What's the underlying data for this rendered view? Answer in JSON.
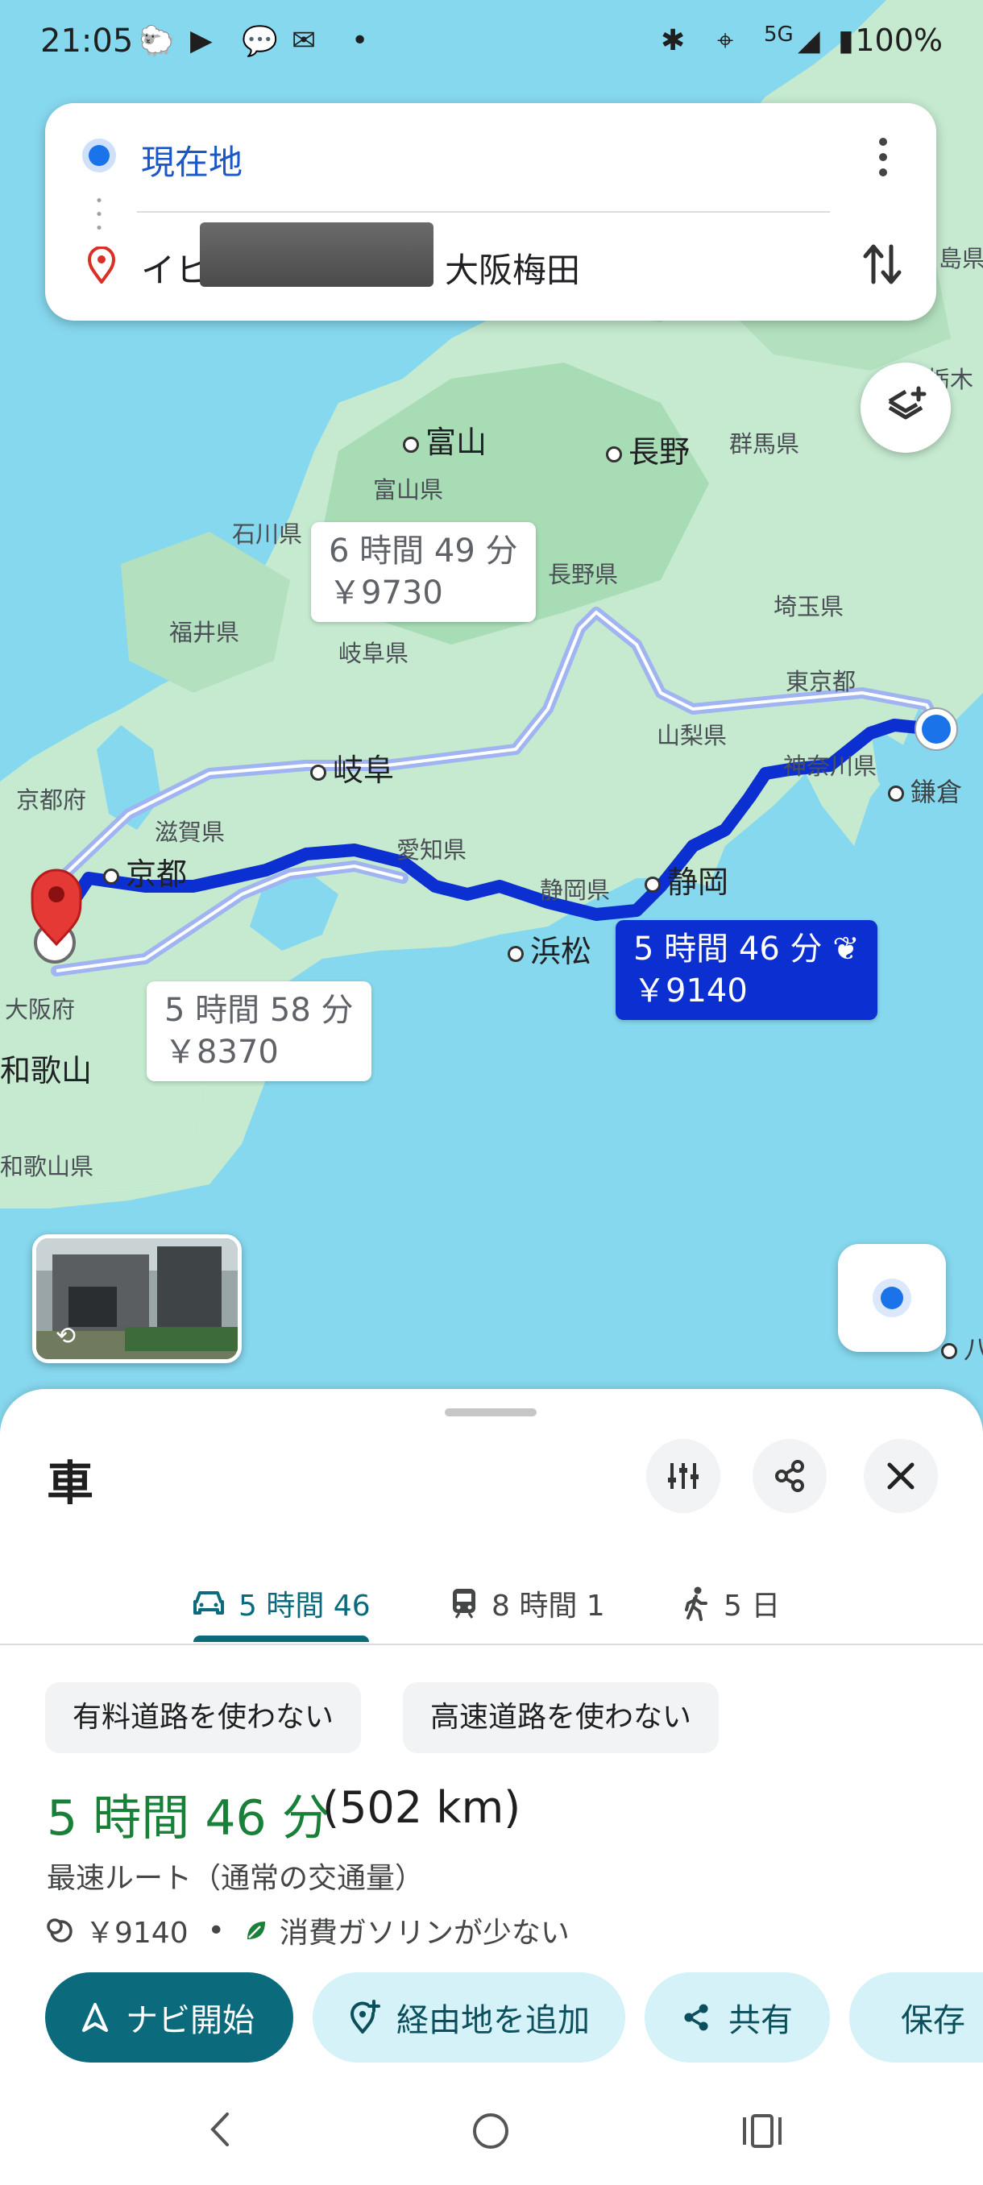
{
  "status_bar": {
    "time": "21:05",
    "network": "5G",
    "battery": "100%",
    "notification_icons": [
      "app-icon",
      "youtube-icon",
      "line-icon",
      "mail-icon",
      "dot"
    ],
    "system_icons": [
      "bluetooth-icon",
      "location-icon",
      "signal-icon",
      "battery-icon"
    ]
  },
  "search": {
    "origin": "現在地",
    "destination_prefix": "イヒ",
    "destination_suffix": "大阪梅田"
  },
  "map": {
    "labels": {
      "toyama": "富山",
      "nagano": "長野",
      "gunma_pref": "群馬県",
      "toyama_pref": "富山県",
      "ishikawa_pref": "石川県",
      "nagano_pref": "長野県",
      "saitama_pref": "埼玉県",
      "fukui_pref": "福井県",
      "gifu_pref": "岐阜県",
      "tokyo_to": "東京都",
      "yamanashi_pref": "山梨県",
      "gifu": "岐阜",
      "kanagawa_pref": "神奈川県",
      "kamakura": "鎌倉",
      "kyoto_fu": "京都府",
      "shiga_pref": "滋賀県",
      "kyoto": "京都",
      "aichi_pref": "愛知県",
      "shizuoka_pref": "静岡県",
      "shizuoka": "静岡",
      "hamamatsu": "浜松",
      "osaka_fu": "大阪府",
      "wakayama": "和歌山",
      "wakayama_pref": "和歌山県",
      "tochigi": "栃木",
      "shima": "島県",
      "hachi": "八"
    },
    "routes": [
      {
        "id": "north",
        "time": "6 時間 49 分",
        "cost": "￥9730",
        "selected": false
      },
      {
        "id": "fastest",
        "time": "5 時間 46 分",
        "cost": "￥9140",
        "selected": true
      },
      {
        "id": "south",
        "time": "5 時間 58 分",
        "cost": "￥8370",
        "selected": false
      }
    ],
    "colors": {
      "selected_route": "#0b2fd1",
      "alt_route": "#9fb4f0",
      "water": "#86d8ef",
      "land": "#bfe7c9"
    }
  },
  "sheet": {
    "title": "車",
    "tabs": [
      {
        "label": "5 時間 46",
        "icon": "car-icon",
        "active": true
      },
      {
        "label": "8 時間 1",
        "icon": "train-icon",
        "active": false
      },
      {
        "label": "5 日",
        "icon": "walk-icon",
        "active": false
      }
    ],
    "chips": [
      "有料道路を使わない",
      "高速道路を使わない"
    ],
    "duration": "5 時間 46 分",
    "distance": "(502 km)",
    "description": "最速ルート（通常の交通量）",
    "toll": "￥9140",
    "separator": "•",
    "eco": "消費ガソリンが少ない",
    "actions": {
      "navigate": "ナビ開始",
      "add_stop": "経由地を追加",
      "share": "共有",
      "save": "保存"
    },
    "accent": "#0b6b7d",
    "duration_color": "#188038"
  }
}
